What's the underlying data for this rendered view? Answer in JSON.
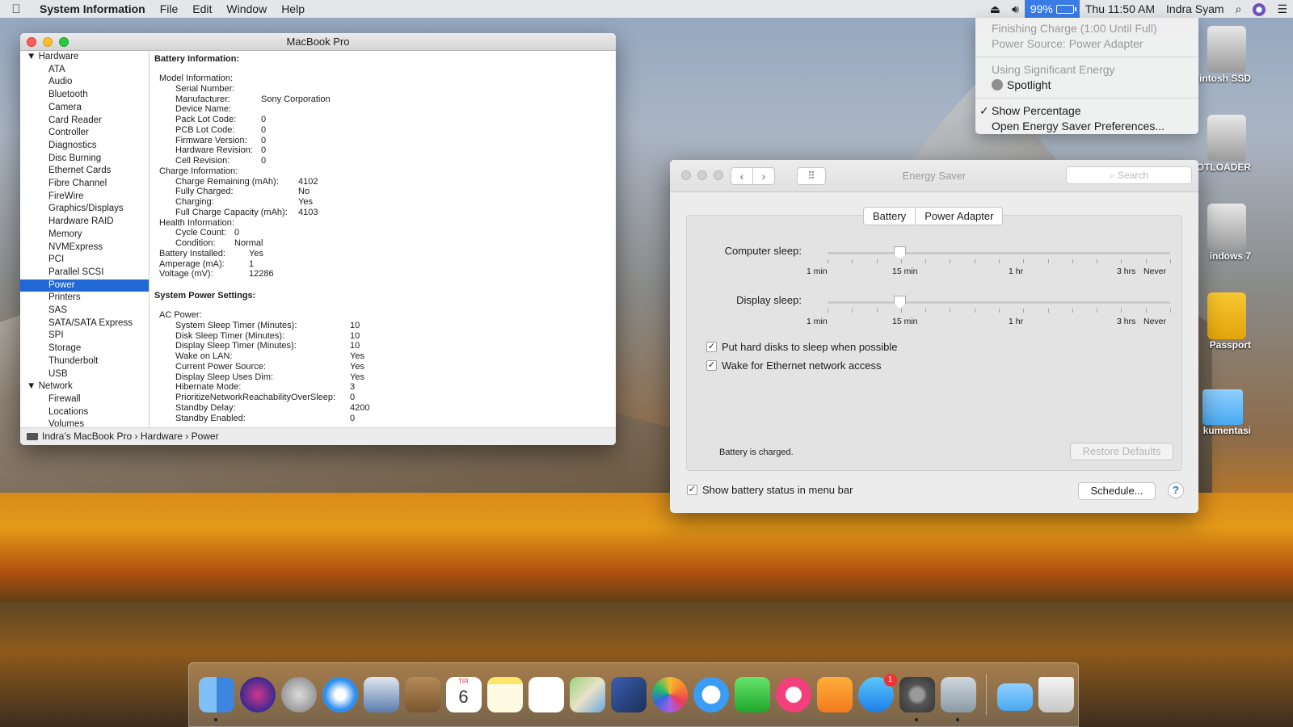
{
  "menubar": {
    "app_name": "System Information",
    "menus": [
      "File",
      "Edit",
      "Window",
      "Help"
    ],
    "battery_percent": "99%",
    "clock": "Thu 11:50 AM",
    "user": "Indra Syam"
  },
  "battery_menu": {
    "status_line1": "Finishing Charge (1:00 Until Full)",
    "status_line2": "Power Source: Power Adapter",
    "energy_heading": "Using Significant Energy",
    "energy_app": "Spotlight",
    "check_mark": "✓",
    "show_percentage": "Show Percentage",
    "open_prefs": "Open Energy Saver Preferences..."
  },
  "desktop_icons": [
    "intosh SSD",
    "OTLOADER",
    "indows 7",
    "Passport",
    "kumentasi"
  ],
  "sysinfo": {
    "title": "MacBook Pro",
    "sidebar": {
      "hardware_label": "Hardware",
      "hardware_items": [
        "ATA",
        "Audio",
        "Bluetooth",
        "Camera",
        "Card Reader",
        "Controller",
        "Diagnostics",
        "Disc Burning",
        "Ethernet Cards",
        "Fibre Channel",
        "FireWire",
        "Graphics/Displays",
        "Hardware RAID",
        "Memory",
        "NVMExpress",
        "PCI",
        "Parallel SCSI",
        "Power",
        "Printers",
        "SAS",
        "SATA/SATA Express",
        "SPI",
        "Storage",
        "Thunderbolt",
        "USB"
      ],
      "selected": "Power",
      "network_label": "Network",
      "network_items": [
        "Firewall",
        "Locations",
        "Volumes"
      ]
    },
    "battery_info": {
      "heading": "Battery Information:",
      "model_heading": "Model Information:",
      "model": [
        {
          "k": "Serial Number:",
          "v": ""
        },
        {
          "k": "Manufacturer:",
          "v": "Sony Corporation"
        },
        {
          "k": "Device Name:",
          "v": ""
        },
        {
          "k": "Pack Lot Code:",
          "v": "0"
        },
        {
          "k": "PCB Lot Code:",
          "v": "0"
        },
        {
          "k": "Firmware Version:",
          "v": "0"
        },
        {
          "k": "Hardware Revision:",
          "v": "0"
        },
        {
          "k": "Cell Revision:",
          "v": "0"
        }
      ],
      "charge_heading": "Charge Information:",
      "charge": [
        {
          "k": "Charge Remaining (mAh):",
          "v": "4102"
        },
        {
          "k": "Fully Charged:",
          "v": "No"
        },
        {
          "k": "Charging:",
          "v": "Yes"
        },
        {
          "k": "Full Charge Capacity (mAh):",
          "v": "4103"
        }
      ],
      "health_heading": "Health Information:",
      "health": [
        {
          "k": "Cycle Count:",
          "v": "0"
        },
        {
          "k": "Condition:",
          "v": "Normal"
        }
      ],
      "other": [
        {
          "k": "Battery Installed:",
          "v": "Yes"
        },
        {
          "k": "Amperage (mA):",
          "v": "1"
        },
        {
          "k": "Voltage (mV):",
          "v": "12286"
        }
      ]
    },
    "power_settings": {
      "heading": "System Power Settings:",
      "ac_heading": "AC Power:",
      "ac": [
        {
          "k": "System Sleep Timer (Minutes):",
          "v": "10"
        },
        {
          "k": "Disk Sleep Timer (Minutes):",
          "v": "10"
        },
        {
          "k": "Display Sleep Timer (Minutes):",
          "v": "10"
        },
        {
          "k": "Wake on LAN:",
          "v": "Yes"
        },
        {
          "k": "Current Power Source:",
          "v": "Yes"
        },
        {
          "k": "Display Sleep Uses Dim:",
          "v": "Yes"
        },
        {
          "k": "Hibernate Mode:",
          "v": "3"
        },
        {
          "k": "PrioritizeNetworkReachabilityOverSleep:",
          "v": "0"
        },
        {
          "k": "Standby Delay:",
          "v": "4200"
        },
        {
          "k": "Standby Enabled:",
          "v": "0"
        }
      ]
    },
    "path": {
      "computer": "Indra’s MacBook Pro",
      "sep": "›",
      "section": "Hardware",
      "item": "Power"
    }
  },
  "energy_saver": {
    "title": "Energy Saver",
    "search_placeholder": "Search",
    "tabs": [
      "Battery",
      "Power Adapter"
    ],
    "active_tab": "Battery",
    "computer_sleep_label": "Computer sleep:",
    "display_sleep_label": "Display sleep:",
    "computer_sleep_level": 0.21,
    "display_sleep_level": 0.21,
    "scale_labels": [
      "1 min",
      "15 min",
      "1 hr",
      "3 hrs",
      "Never"
    ],
    "checkboxes": [
      {
        "label": "Put hard disks to sleep when possible",
        "checked": true
      },
      {
        "label": "Wake for Ethernet network access",
        "checked": true
      }
    ],
    "status": "Battery is charged.",
    "restore_defaults": "Restore Defaults",
    "show_battery_status": "Show battery status in menu bar",
    "schedule": "Schedule...",
    "help": "?"
  },
  "dock": {
    "calendar_month": "TIR",
    "calendar_day": "6",
    "app_store_badge": "1"
  },
  "colors": {
    "selection": "#2167d6",
    "menu_highlight": "#3b7be8"
  }
}
